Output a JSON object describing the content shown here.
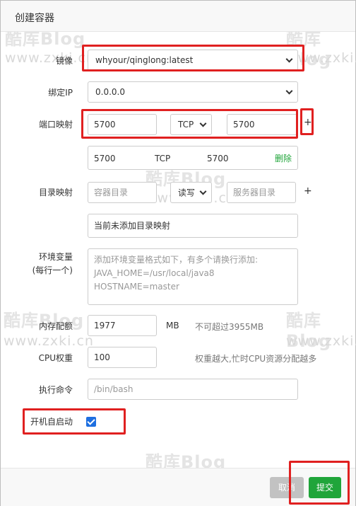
{
  "dialog": {
    "title": "创建容器"
  },
  "watermark": {
    "brand": "酷库Blog",
    "url": "www.zxki.cn"
  },
  "image": {
    "label": "镜像",
    "value": "whyour/qinglong:latest"
  },
  "bind_ip": {
    "label": "绑定IP",
    "value": "0.0.0.0"
  },
  "port": {
    "label": "端口映射",
    "host": "5700",
    "protocol": "TCP",
    "container": "5700",
    "add": "+",
    "mapped": {
      "host": "5700",
      "protocol": "TCP",
      "container": "5700",
      "delete": "删除"
    }
  },
  "dir": {
    "label": "目录映射",
    "container_placeholder": "容器目录",
    "mode": "读写",
    "host_placeholder": "服务器目录",
    "add": "+",
    "empty_text": "当前未添加目录映射"
  },
  "env": {
    "label_line1": "环境变量",
    "label_line2": "(每行一个)",
    "placeholder_line1": "添加环境变量格式如下，有多个请换行添加:",
    "placeholder_line2": "JAVA_HOME=/usr/local/java8",
    "placeholder_line3": "HOSTNAME=master"
  },
  "memory": {
    "label": "内存配额",
    "value": "1977",
    "unit": "MB",
    "hint": "不可超过3955MB"
  },
  "cpu": {
    "label": "CPU权重",
    "value": "100",
    "hint": "权重越大,忙时CPU资源分配越多"
  },
  "command": {
    "label": "执行命令",
    "placeholder": "/bin/bash"
  },
  "autostart": {
    "label": "开机自启动",
    "checked": true
  },
  "buttons": {
    "cancel": "取消",
    "submit": "提交"
  },
  "colors": {
    "submit": "#20a53a",
    "delete": "#20a53a",
    "highlight": "#e02020",
    "checkbox": "#1e6fe0"
  }
}
